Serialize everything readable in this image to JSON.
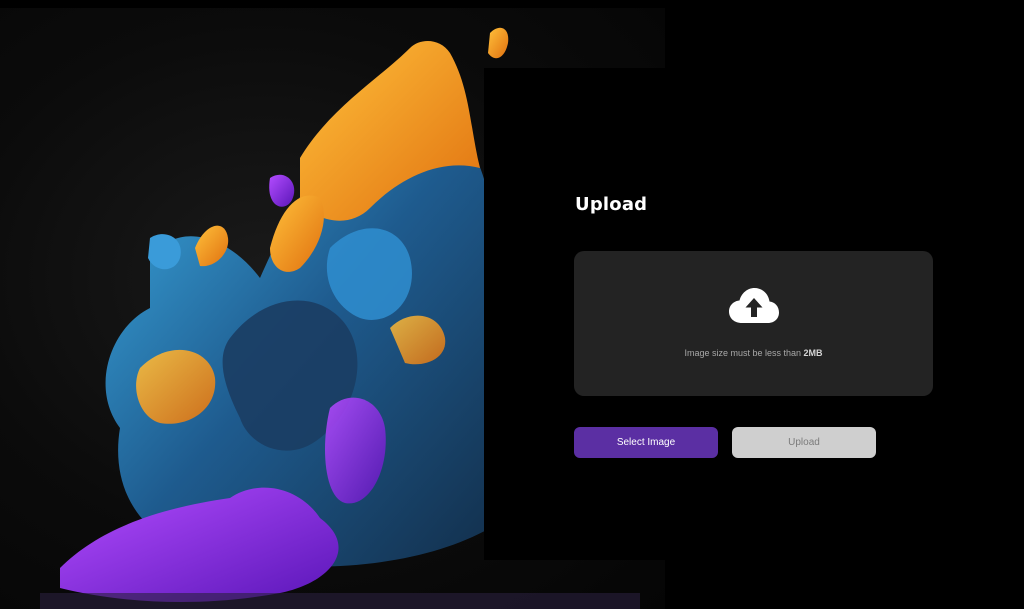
{
  "upload_panel": {
    "title": "Upload",
    "dropzone": {
      "icon": "cloud-upload-icon",
      "hint_prefix": "Image size must be less than ",
      "hint_limit": "2MB"
    },
    "select_button_label": "Select Image",
    "upload_button_label": "Upload"
  },
  "colors": {
    "background": "#000000",
    "dropzone": "#232323",
    "select_button": "#5b2fa3",
    "upload_button": "#cfcfcf",
    "art_orange": "#f39a1e",
    "art_blue": "#2a86c9",
    "art_purple": "#8a2be2"
  }
}
